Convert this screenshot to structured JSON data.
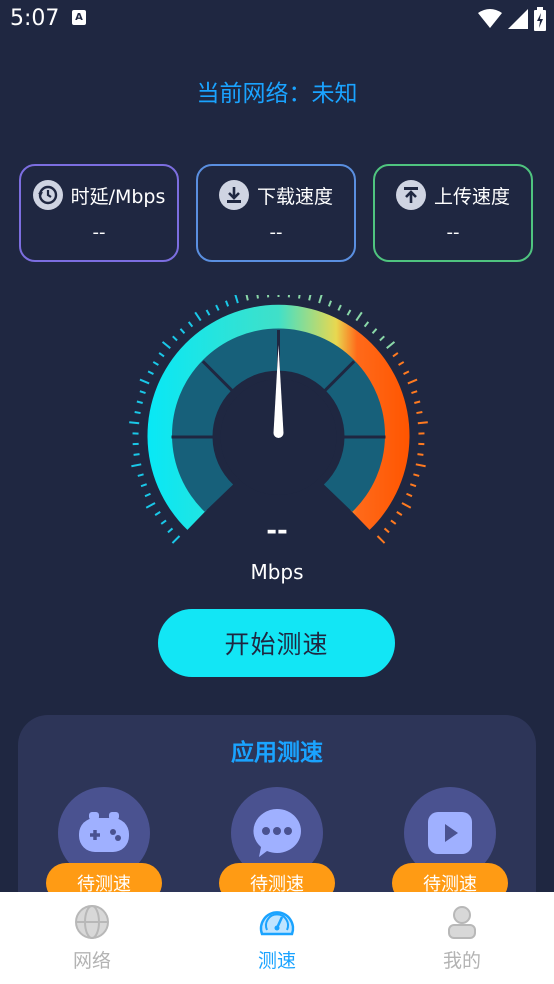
{
  "status_bar": {
    "time": "5:07",
    "notif_letter": "A"
  },
  "network": {
    "label": "当前网络：",
    "value": "未知"
  },
  "stats": [
    {
      "label": "时延/Mbps",
      "value": "--",
      "icon": "history-icon"
    },
    {
      "label": "下载速度",
      "value": "--",
      "icon": "download-icon"
    },
    {
      "label": "上传速度",
      "value": "--",
      "icon": "upload-icon"
    }
  ],
  "gauge": {
    "value": "--",
    "unit": "Mbps",
    "level": 0
  },
  "start_button": "开始测速",
  "app_speed": {
    "title": "应用测速",
    "items": [
      {
        "icon": "gamepad-icon",
        "status": "待测速"
      },
      {
        "icon": "chat-icon",
        "status": "待测速"
      },
      {
        "icon": "video-icon",
        "status": "待测速"
      }
    ]
  },
  "nav": [
    {
      "label": "网络",
      "icon": "globe-icon",
      "active": false
    },
    {
      "label": "测速",
      "icon": "speedometer-icon",
      "active": true
    },
    {
      "label": "我的",
      "icon": "person-icon",
      "active": false
    }
  ],
  "colors": {
    "accent": "#1aa3ff",
    "button": "#12e6f5",
    "badge": "#ff9b14",
    "background": "#1f2741"
  }
}
